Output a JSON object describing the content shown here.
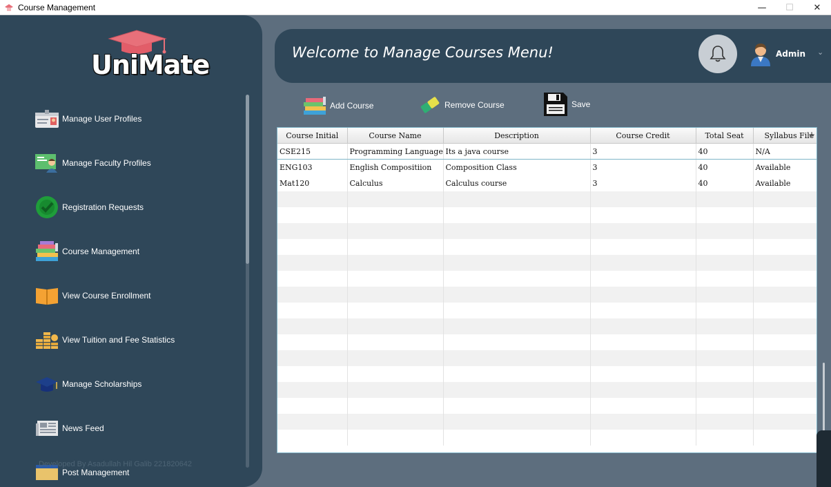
{
  "window": {
    "title": "Course Management",
    "controls": [
      "—",
      "☐",
      "✕"
    ]
  },
  "logo": {
    "text": "UniMate"
  },
  "sidebar": {
    "items": [
      {
        "label": "Manage User Profiles",
        "icon": "id-card-icon"
      },
      {
        "label": "Manage Faculty Profiles",
        "icon": "faculty-board-icon"
      },
      {
        "label": "Registration Requests",
        "icon": "check-circle-icon"
      },
      {
        "label": "Course Management",
        "icon": "books-stack-icon"
      },
      {
        "label": "View Course Enrollment",
        "icon": "open-book-icon"
      },
      {
        "label": "View Tuition and Fee Statistics",
        "icon": "coins-icon"
      },
      {
        "label": "Manage Scholarships",
        "icon": "graduation-cap-icon"
      },
      {
        "label": "News Feed",
        "icon": "newspaper-icon"
      },
      {
        "label": "Post Management",
        "icon": "post-card-icon"
      }
    ],
    "credit": "Developed By Asadullah Hil Galib 221820642"
  },
  "header": {
    "welcome": "Welcome to Manage Courses Menu!",
    "user_name": "Admin"
  },
  "toolbar": {
    "add_label": "Add Course",
    "remove_label": "Remove Course",
    "save_label": "Save"
  },
  "table": {
    "columns": [
      "Course Initial",
      "Course Name",
      "Description",
      "Course Credit",
      "Total Seat",
      "Syllabus File"
    ],
    "rows": [
      [
        "CSE215",
        "Programming Language II",
        "Its a java course",
        "3",
        "40",
        "N/A"
      ],
      [
        "ENG103",
        "English Compositiion",
        "Composition Class",
        "3",
        "40",
        "Available"
      ],
      [
        "Mat120",
        "Calculus",
        "Calculus course",
        "3",
        "40",
        "Available"
      ]
    ],
    "column_control": "+"
  },
  "colors": {
    "sidebar": "#2f4759",
    "background": "#5d6e7e",
    "selection": "#7fb5c9"
  }
}
